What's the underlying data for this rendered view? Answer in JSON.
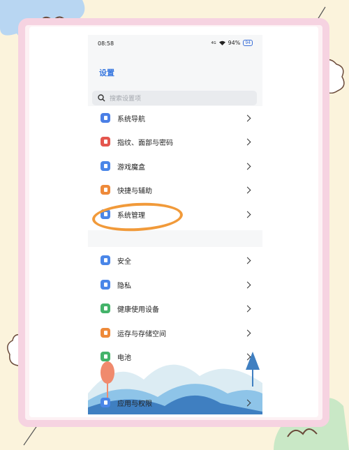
{
  "status_bar": {
    "time": "08:58",
    "network": "4G",
    "battery": "94%",
    "battery_badge": "94"
  },
  "page": {
    "title": "设置"
  },
  "search": {
    "placeholder": "搜索设置项"
  },
  "groups": [
    {
      "items": [
        {
          "label": "系统导航",
          "icon": "navigation-icon",
          "color": "#4a7fe6"
        },
        {
          "label": "指纹、面部与密码",
          "icon": "fingerprint-icon",
          "color": "#e4564e"
        },
        {
          "label": "游戏魔盒",
          "icon": "game-icon",
          "color": "#4a86e8"
        },
        {
          "label": "快捷与辅助",
          "icon": "shortcut-icon",
          "color": "#ee8a3a"
        },
        {
          "label": "系统管理",
          "icon": "system-icon",
          "color": "#4a86e8"
        }
      ]
    },
    {
      "items": [
        {
          "label": "安全",
          "icon": "security-icon",
          "color": "#4a86e8"
        },
        {
          "label": "隐私",
          "icon": "privacy-lock-icon",
          "color": "#4a86e8"
        },
        {
          "label": "健康使用设备",
          "icon": "health-icon",
          "color": "#44b36a"
        },
        {
          "label": "运存与存储空间",
          "icon": "storage-icon",
          "color": "#ee8a3a"
        },
        {
          "label": "电池",
          "icon": "battery-icon",
          "color": "#44b36a"
        },
        {
          "label": "应用与权限",
          "icon": "apps-icon",
          "color": "#4a86e8"
        }
      ]
    }
  ],
  "colors": {
    "accent": "#3a79e0",
    "highlight_circle": "#f19a3a",
    "frame": "#f6d3e1"
  }
}
